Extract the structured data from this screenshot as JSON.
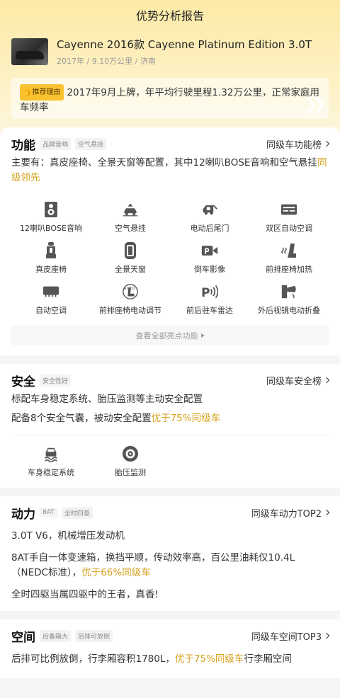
{
  "header": {
    "title": "优势分析报告"
  },
  "car": {
    "name": "Cayenne 2016款 Cayenne Platinum Edition 3.0T",
    "meta": "2017年 / 9.10万公里 / 济南"
  },
  "reason": {
    "badge": "推荐理由",
    "text": "2017年9月上牌，年平均行驶里程1.32万公里，正常家庭用车频率"
  },
  "features": {
    "title": "功能",
    "tags": [
      "品牌音响",
      "空气悬挂"
    ],
    "link": "同级车功能榜",
    "desc_main": "主要有：真皮座椅、全景天窗等配置，其中12喇叭BOSE音响和空气悬挂",
    "desc_hl": "同级领先",
    "items": [
      {
        "label": "12喇叭BOSE音响",
        "icon": "speaker-icon"
      },
      {
        "label": "空气悬挂",
        "icon": "air-suspension-icon"
      },
      {
        "label": "电动后尾门",
        "icon": "power-tailgate-icon"
      },
      {
        "label": "双区自动空调",
        "icon": "dual-zone-ac-icon"
      },
      {
        "label": "真皮座椅",
        "icon": "leather-seat-icon"
      },
      {
        "label": "全景天窗",
        "icon": "panoramic-sunroof-icon"
      },
      {
        "label": "倒车影像",
        "icon": "reverse-camera-icon"
      },
      {
        "label": "前排座椅加热",
        "icon": "seat-heating-icon"
      },
      {
        "label": "自动空调",
        "icon": "auto-ac-icon"
      },
      {
        "label": "前排座椅电动调节",
        "icon": "power-seat-icon"
      },
      {
        "label": "前后驻车雷达",
        "icon": "parking-radar-icon"
      },
      {
        "label": "外后视镜电动折叠",
        "icon": "mirror-fold-icon"
      }
    ],
    "more": "查看全部亮点功能"
  },
  "safety": {
    "title": "安全",
    "tags": [
      "安全性好"
    ],
    "link": "同级车安全榜",
    "line1": "标配车身稳定系统、胎压监测等主动安全配置",
    "line2_main": "配备8个安全气囊，被动安全配置",
    "line2_hl": "优于75%同级车",
    "items": [
      {
        "label": "车身稳定系统",
        "icon": "stability-control-icon"
      },
      {
        "label": "胎压监测",
        "icon": "tire-pressure-icon"
      }
    ]
  },
  "power": {
    "title": "动力",
    "tags": [
      "8AT",
      "全时四驱"
    ],
    "link": "同级车动力TOP2",
    "line1": "3.0T V6，机械增压发动机",
    "line2_main": "8AT手自一体变速箱，换挡平顺，传动效率高，百公里油耗仅10.4L（NEDC标准），",
    "line2_hl": "优于66%同级车",
    "line3": "全时四驱当属四驱中的王者，真香!"
  },
  "space": {
    "title": "空间",
    "tags": [
      "后备箱大",
      "后排可放倒"
    ],
    "link": "同级车空间TOP3",
    "line_main": "后排可比例放倒，行李厢容积1780L，",
    "line_hl": "优于75%同级车",
    "line_tail": "行李厢空间"
  },
  "colors": {
    "accent": "#d6a21f",
    "badge": "#f9c22e"
  }
}
